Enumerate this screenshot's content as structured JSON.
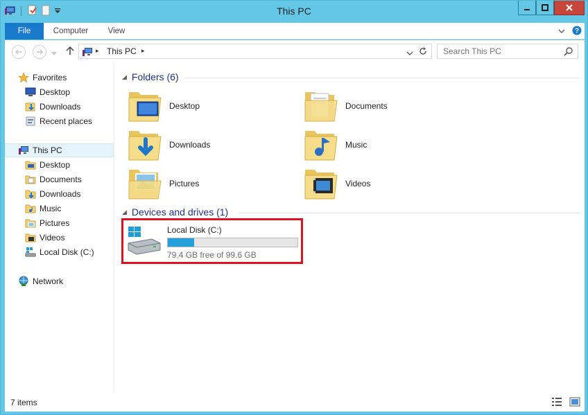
{
  "window": {
    "title": "This PC"
  },
  "icons": {
    "qat": [
      "computer-icon",
      "properties-icon",
      "new-folder-icon",
      "customize-qat-icon"
    ],
    "caption": [
      "minimize-icon",
      "maximize-icon",
      "close-icon"
    ]
  },
  "ribbon": {
    "tabs": [
      {
        "label": "File"
      },
      {
        "label": "Computer"
      },
      {
        "label": "View"
      }
    ]
  },
  "address": {
    "path": "This PC",
    "separator": "▸"
  },
  "search": {
    "placeholder": "Search This PC"
  },
  "nav": {
    "favorites": {
      "label": "Favorites",
      "items": [
        {
          "label": "Desktop",
          "icon": "desktop-icon"
        },
        {
          "label": "Downloads",
          "icon": "downloads-icon"
        },
        {
          "label": "Recent places",
          "icon": "recent-places-icon"
        }
      ]
    },
    "this_pc": {
      "label": "This PC",
      "items": [
        {
          "label": "Desktop",
          "icon": "folder-icon"
        },
        {
          "label": "Documents",
          "icon": "folder-icon"
        },
        {
          "label": "Downloads",
          "icon": "folder-icon"
        },
        {
          "label": "Music",
          "icon": "folder-icon"
        },
        {
          "label": "Pictures",
          "icon": "folder-icon"
        },
        {
          "label": "Videos",
          "icon": "folder-icon"
        },
        {
          "label": "Local Disk (C:)",
          "icon": "drive-icon"
        }
      ]
    },
    "network": {
      "label": "Network"
    }
  },
  "main": {
    "folders_header": "Folders (6)",
    "folders": [
      {
        "label": "Desktop",
        "icon": "desktop-folder-icon"
      },
      {
        "label": "Documents",
        "icon": "documents-folder-icon"
      },
      {
        "label": "Downloads",
        "icon": "downloads-folder-icon"
      },
      {
        "label": "Music",
        "icon": "music-folder-icon"
      },
      {
        "label": "Pictures",
        "icon": "pictures-folder-icon"
      },
      {
        "label": "Videos",
        "icon": "videos-folder-icon"
      }
    ],
    "devices_header": "Devices and drives (1)",
    "drive": {
      "name": "Local Disk (C:)",
      "free_text": "79.4 GB free of 99.6 GB",
      "used_fraction": 0.203,
      "bar_color": "#26a0da"
    }
  },
  "status": {
    "text": "7 items"
  },
  "colors": {
    "accent": "#1979ca",
    "title_bar": "#65c7e6",
    "highlight": "#e0101e"
  }
}
